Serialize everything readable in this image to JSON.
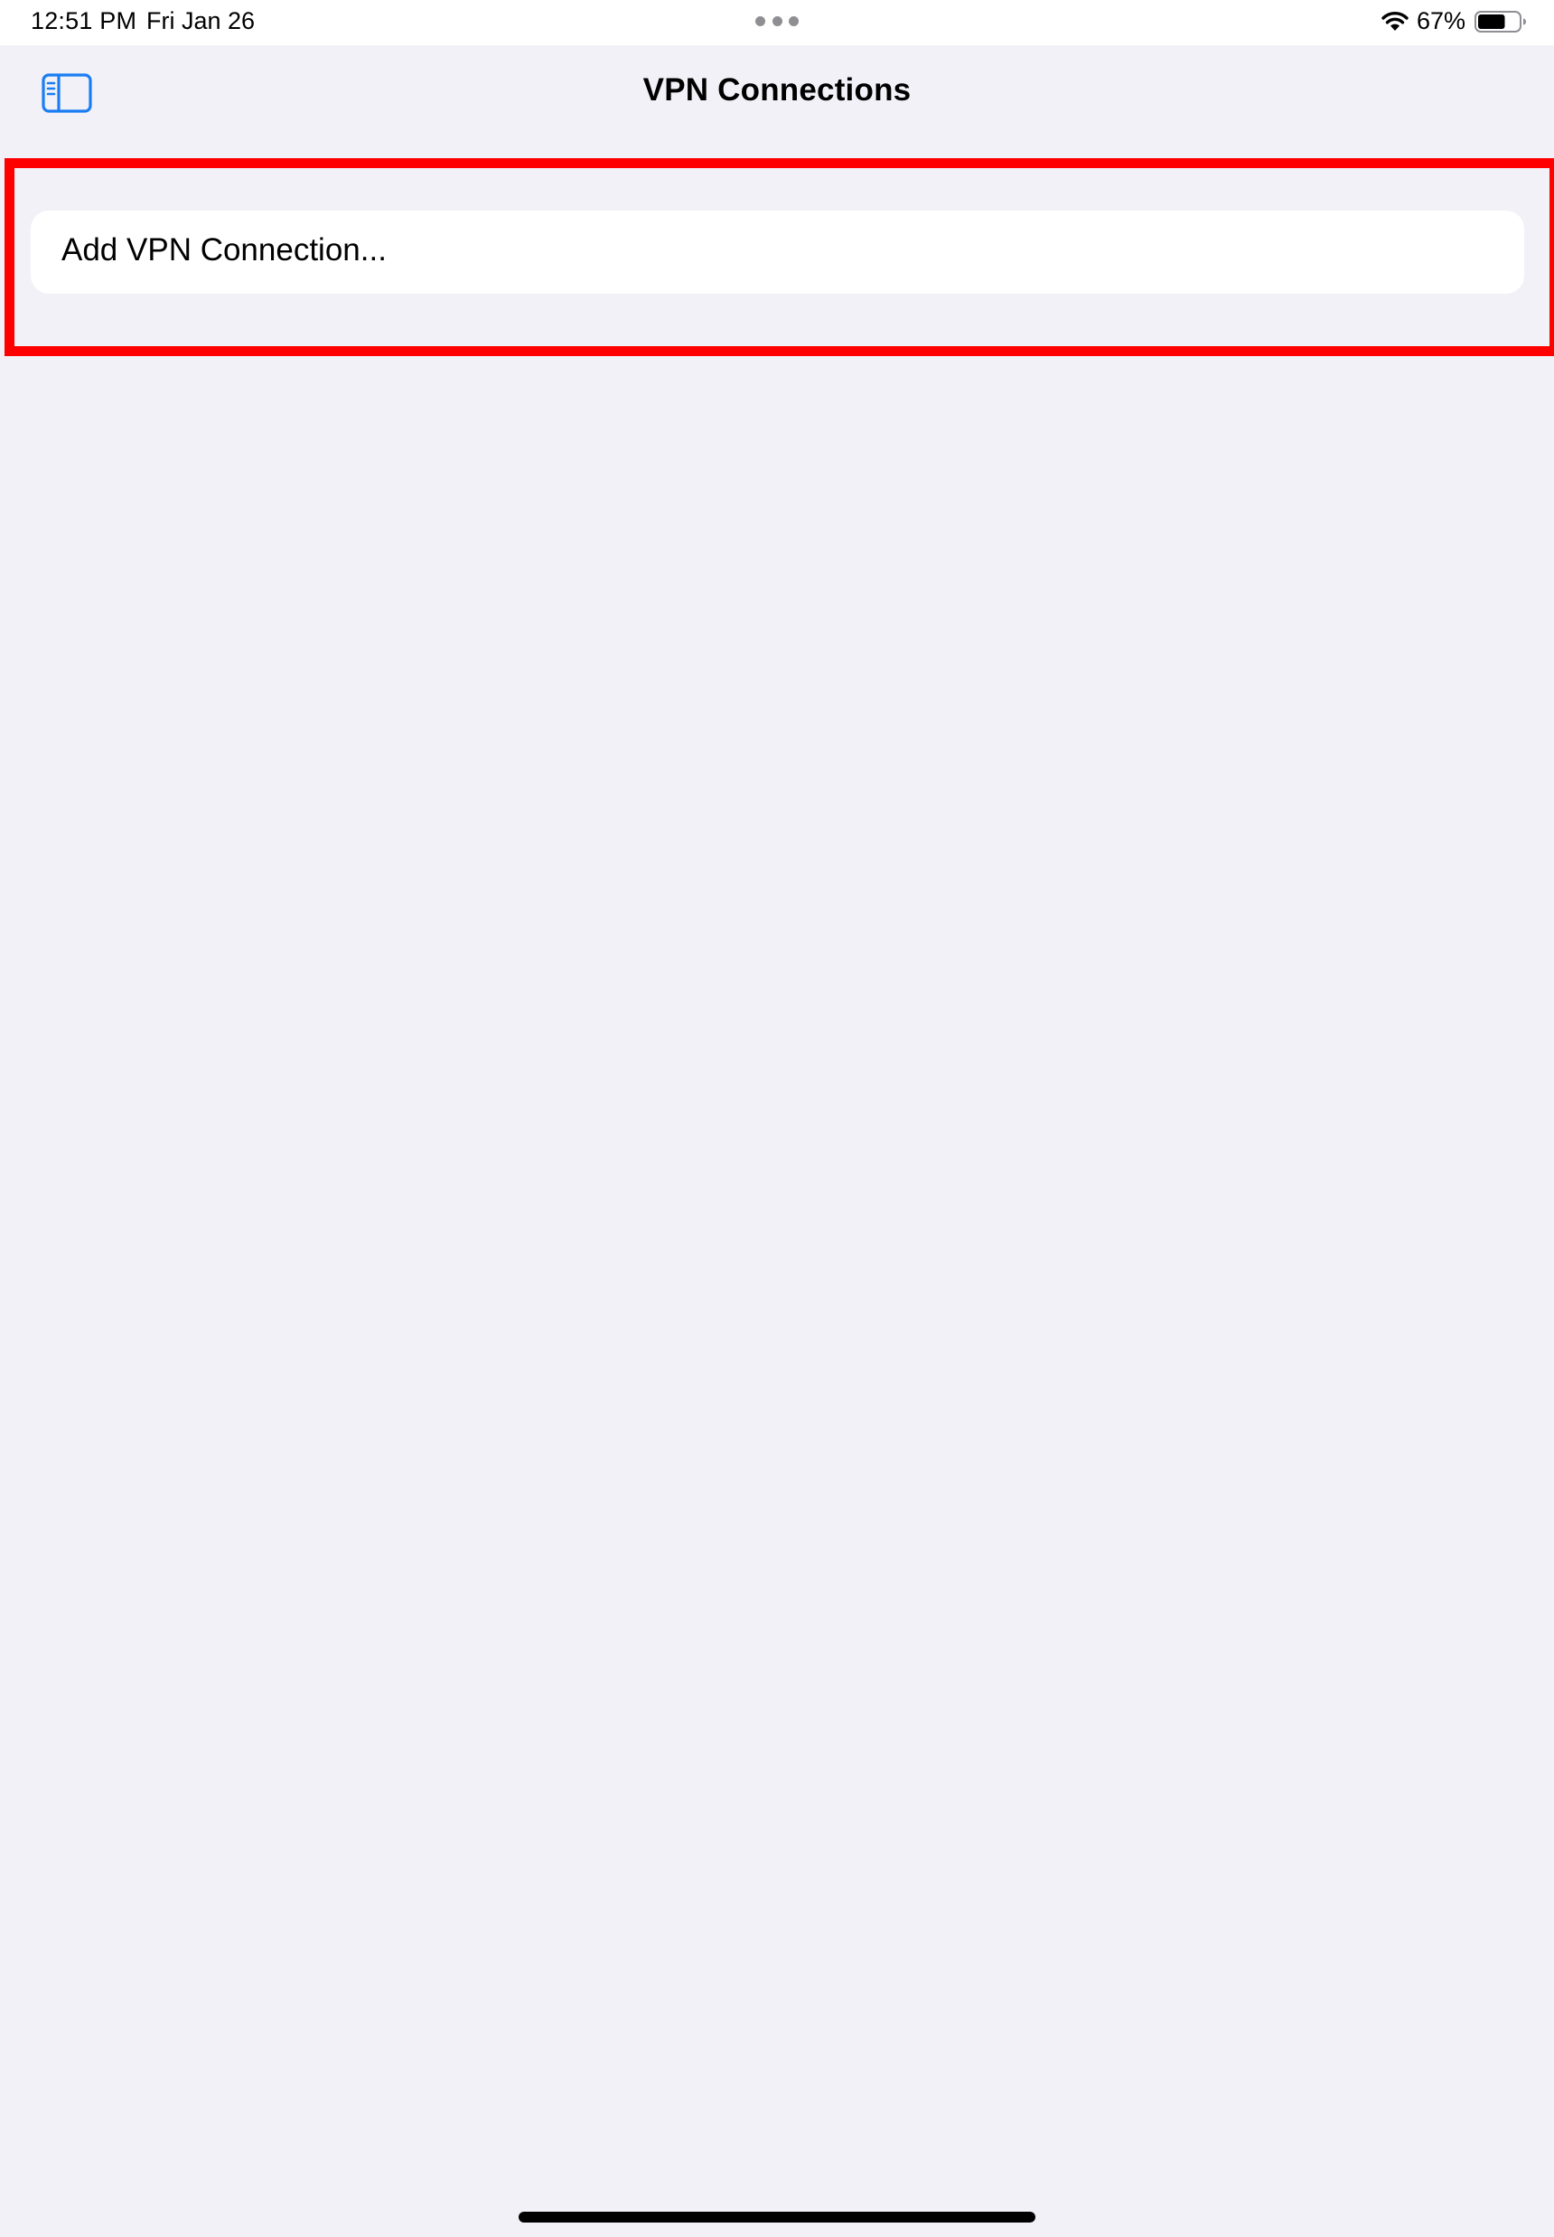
{
  "status_bar": {
    "time": "12:51 PM",
    "date": "Fri Jan 26",
    "battery_percent": "67%",
    "battery_level": 0.67,
    "wifi_icon": "wifi-icon",
    "battery_icon": "battery-icon"
  },
  "nav": {
    "title": "VPN Connections",
    "sidebar_toggle_icon": "sidebar-toggle-icon"
  },
  "main": {
    "add_vpn_label": "Add VPN Connection..."
  },
  "colors": {
    "accent": "#1a7ef2",
    "background": "#f2f1f7",
    "highlight": "#ff0000"
  }
}
